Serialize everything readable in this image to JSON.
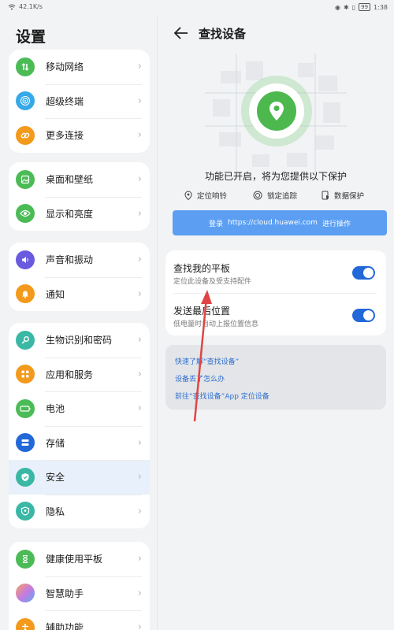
{
  "status_bar": {
    "speed": "42.1K/s",
    "battery": "99",
    "time": "1:38"
  },
  "left_panel": {
    "title": "设置",
    "groups": [
      [
        {
          "label": "移动网络",
          "icon": "signal-icon",
          "color": "#4bbb56"
        },
        {
          "label": "超级终端",
          "icon": "super-device-icon",
          "color": "#37a9e8"
        },
        {
          "label": "更多连接",
          "icon": "link-icon",
          "color": "#f39a1c"
        }
      ],
      [
        {
          "label": "桌面和壁纸",
          "icon": "wallpaper-icon",
          "color": "#4bbb56"
        },
        {
          "label": "显示和亮度",
          "icon": "eye-icon",
          "color": "#4bbb56"
        }
      ],
      [
        {
          "label": "声音和振动",
          "icon": "speaker-icon",
          "color": "#6a5ae0"
        },
        {
          "label": "通知",
          "icon": "bell-icon",
          "color": "#f39a1c"
        }
      ],
      [
        {
          "label": "生物识别和密码",
          "icon": "key-icon",
          "color": "#3ab7a5"
        },
        {
          "label": "应用和服务",
          "icon": "apps-icon",
          "color": "#f39a1c"
        },
        {
          "label": "电池",
          "icon": "battery-icon",
          "color": "#4bbb56"
        },
        {
          "label": "存储",
          "icon": "storage-icon",
          "color": "#2268d8"
        },
        {
          "label": "安全",
          "icon": "shield-icon",
          "color": "#3ab7a5"
        },
        {
          "label": "隐私",
          "icon": "privacy-icon",
          "color": "#3ab7a5"
        }
      ],
      [
        {
          "label": "健康使用平板",
          "icon": "hourglass-icon",
          "color": "#4bbb56"
        },
        {
          "label": "智慧助手",
          "icon": "assistant-icon",
          "color": "#c77be0"
        },
        {
          "label": "辅助功能",
          "icon": "accessibility-icon",
          "color": "#f39a1c"
        }
      ]
    ]
  },
  "right_panel": {
    "title": "查找设备",
    "headline": "功能已开启，将为您提供以下保护",
    "features": [
      {
        "label": "定位响铃",
        "icon": "location-ring-icon"
      },
      {
        "label": "锁定追踪",
        "icon": "lock-track-icon"
      },
      {
        "label": "数据保护",
        "icon": "data-protect-icon"
      }
    ],
    "login": {
      "prefix": "登录",
      "url": "https://cloud.huawei.com",
      "suffix": "进行操作"
    },
    "settings": [
      {
        "title": "查找我的平板",
        "desc": "定位此设备及受支持配件",
        "on": true
      },
      {
        "title": "发送最后位置",
        "desc": "低电量时自动上报位置信息",
        "on": true
      }
    ],
    "links": [
      "快速了解“查找设备”",
      "设备丢了怎么办",
      "前往“查找设备”App 定位设备"
    ]
  }
}
